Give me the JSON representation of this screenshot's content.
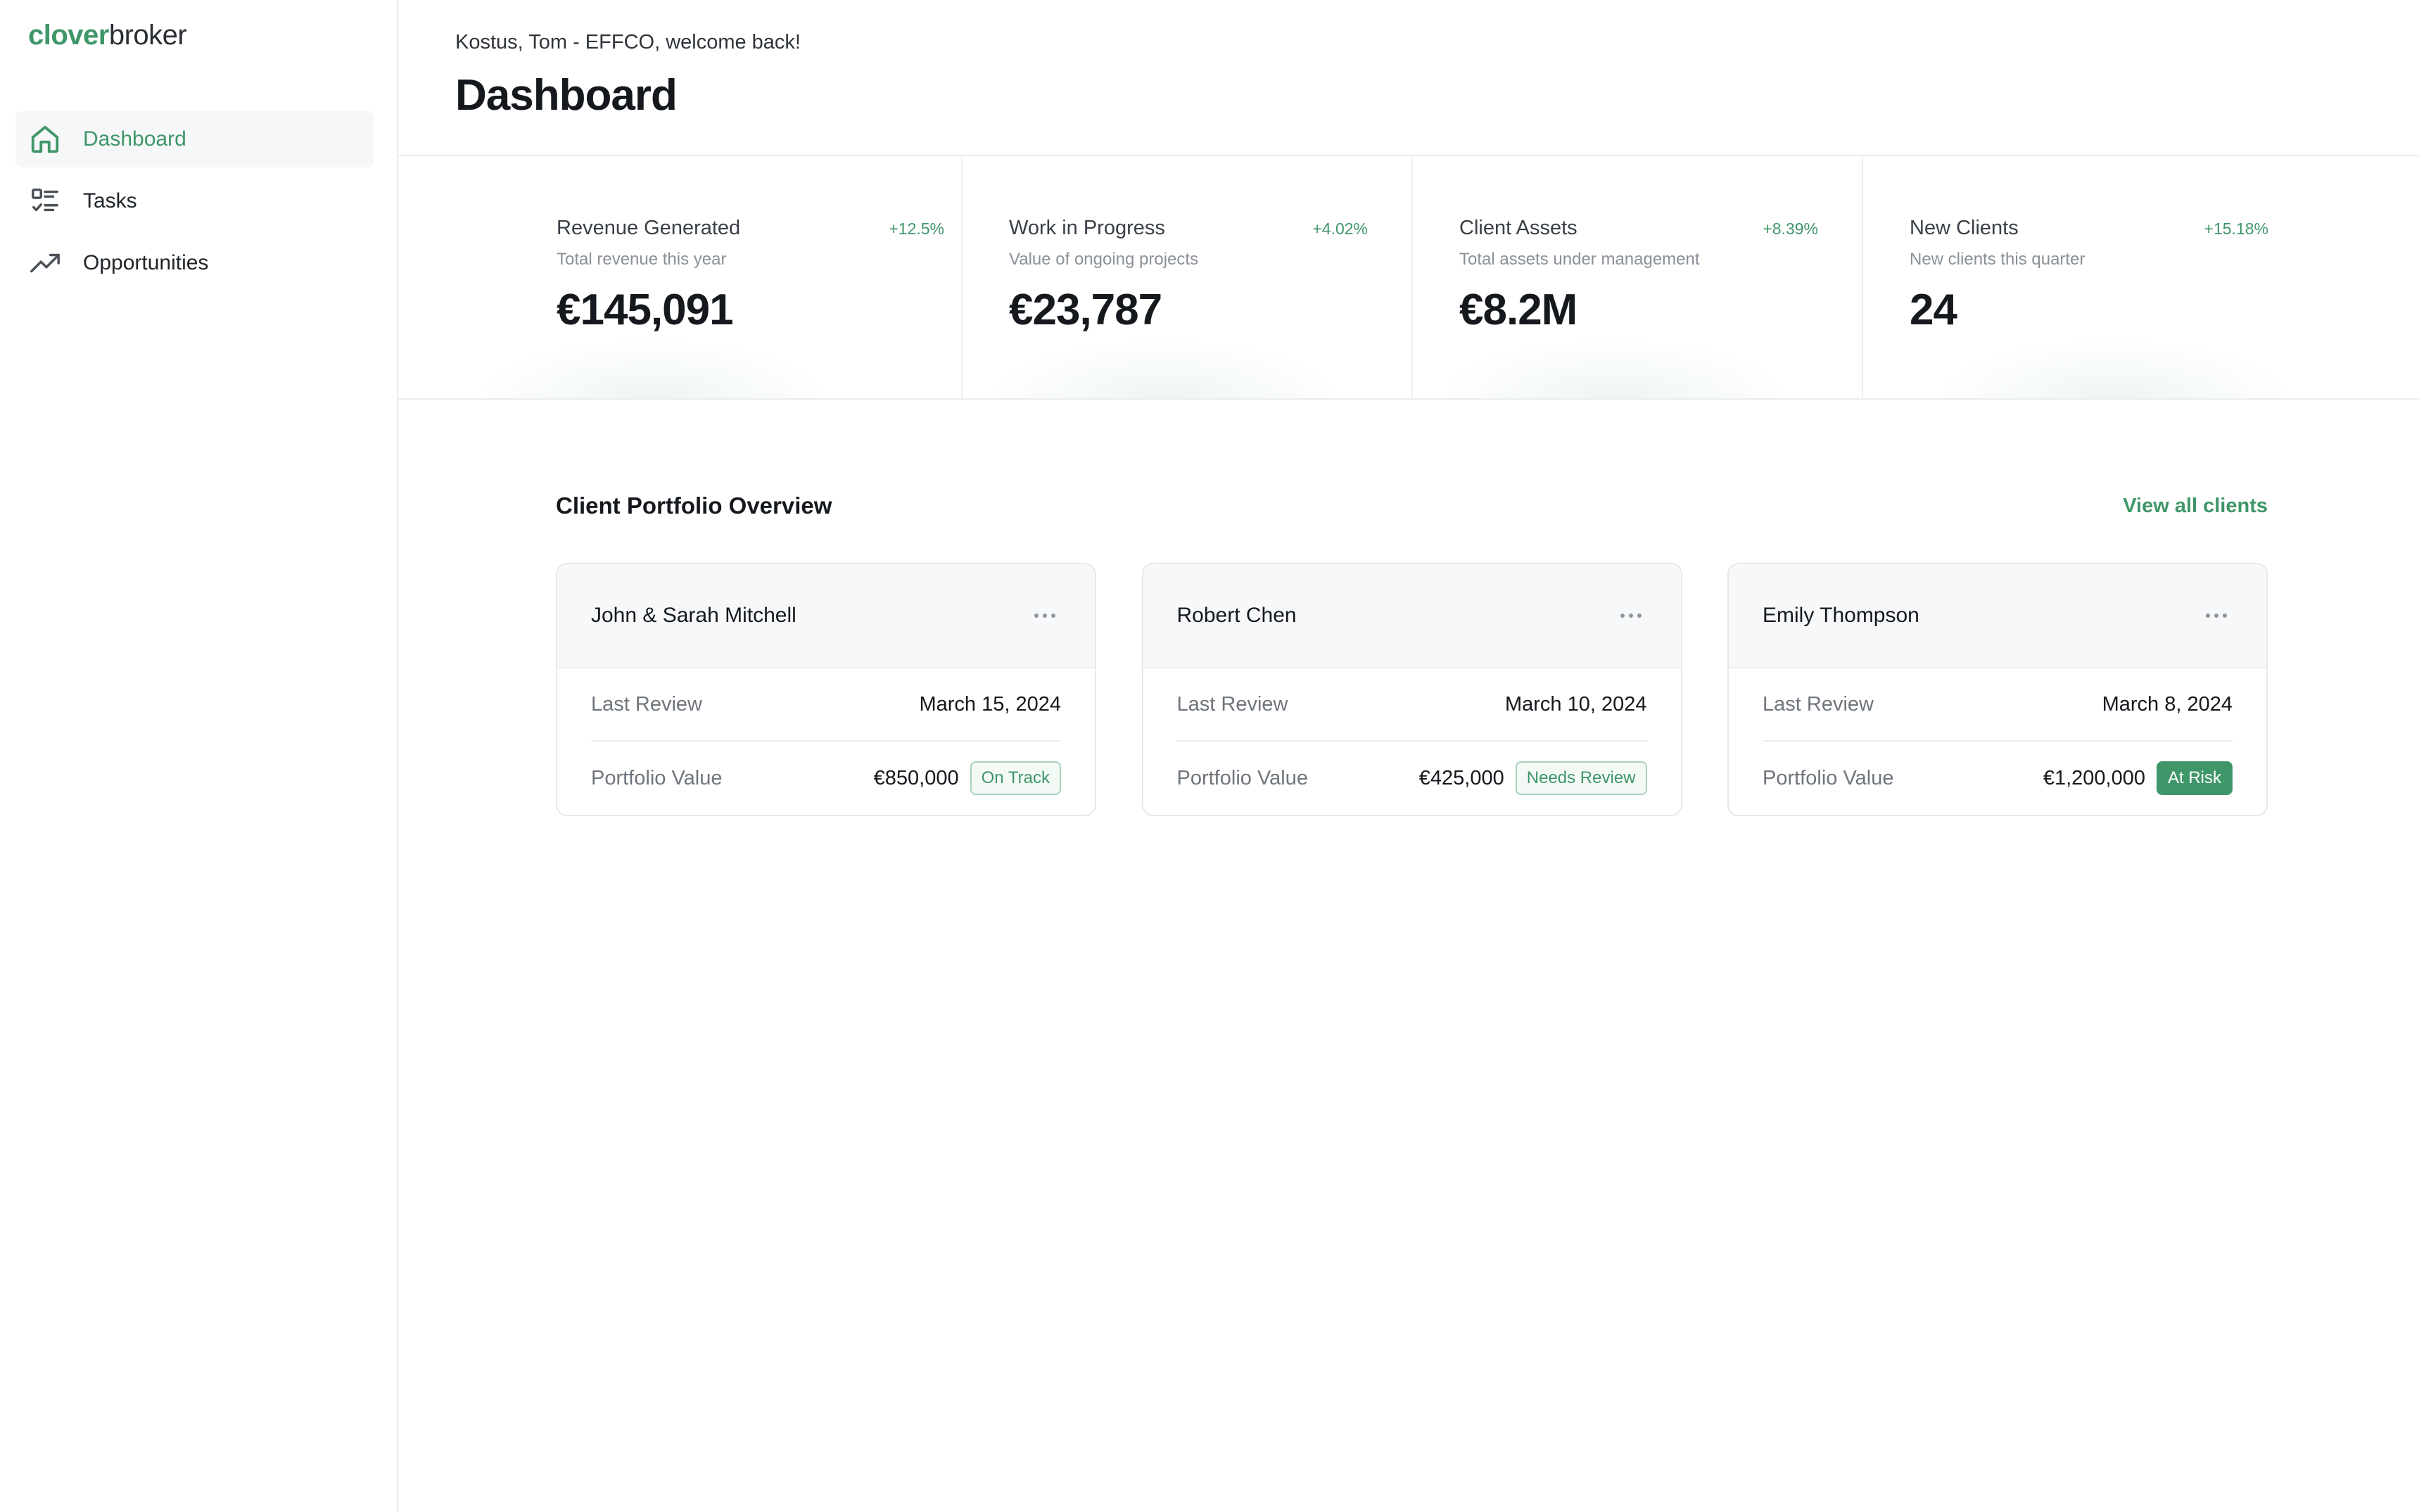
{
  "brand": {
    "part1": "clover",
    "part2": "broker",
    "accent": "#3f9669"
  },
  "sidebar": {
    "items": [
      {
        "label": "Dashboard",
        "icon": "home-icon",
        "active": true
      },
      {
        "label": "Tasks",
        "icon": "tasks-icon",
        "active": false
      },
      {
        "label": "Opportunities",
        "icon": "trending-up-icon",
        "active": false
      }
    ]
  },
  "header": {
    "welcome": "Kostus, Tom - EFFCO, welcome back!",
    "title": "Dashboard"
  },
  "stats": [
    {
      "label": "Revenue Generated",
      "change": "+12.5%",
      "sub": "Total revenue this year",
      "value": "€145,091"
    },
    {
      "label": "Work in Progress",
      "change": "+4.02%",
      "sub": "Value of ongoing projects",
      "value": "€23,787"
    },
    {
      "label": "Client Assets",
      "change": "+8.39%",
      "sub": "Total assets under management",
      "value": "€8.2M"
    },
    {
      "label": "New Clients",
      "change": "+15.18%",
      "sub": "New clients this quarter",
      "value": "24"
    }
  ],
  "portfolio": {
    "title": "Client Portfolio Overview",
    "view_all": "View all clients",
    "clients": [
      {
        "name": "John & Sarah Mitchell",
        "review_label": "Last Review",
        "review_date": "March 15, 2024",
        "value_label": "Portfolio Value",
        "value": "€850,000",
        "status": "On Track"
      },
      {
        "name": "Robert Chen",
        "review_label": "Last Review",
        "review_date": "March 10, 2024",
        "value_label": "Portfolio Value",
        "value": "€425,000",
        "status": "Needs Review"
      },
      {
        "name": "Emily Thompson",
        "review_label": "Last Review",
        "review_date": "March 8, 2024",
        "value_label": "Portfolio Value",
        "value": "€1,200,000",
        "status": "At Risk"
      }
    ]
  }
}
